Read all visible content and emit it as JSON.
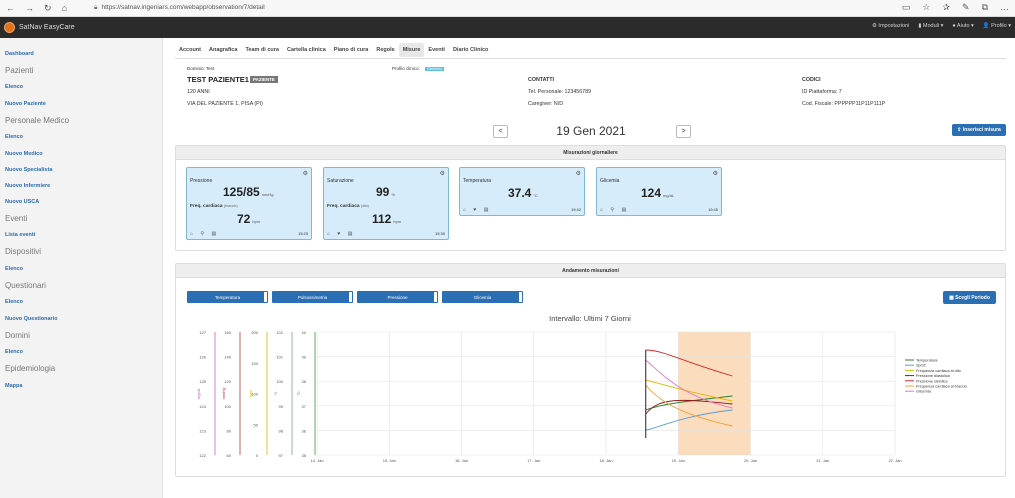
{
  "browser": {
    "url": "https://satnav.ingeniars.com/webapp/observation/7/detail",
    "nav_back": "←",
    "nav_forward": "→",
    "nav_refresh": "↻",
    "nav_home": "⌂",
    "right_icons": [
      "▭",
      "☆",
      "✰",
      "✎",
      "⧉",
      "…"
    ]
  },
  "navbar": {
    "brand": "SatNav EasyCare",
    "menu": [
      "⚙ Impostazioni",
      "▮ Moduli ▾",
      "● Aiuto ▾",
      "👤 Profilo ▾"
    ]
  },
  "sidebar": {
    "entries": [
      {
        "type": "link",
        "label": "Dashboard"
      },
      {
        "type": "section",
        "label": "Pazienti"
      },
      {
        "type": "link",
        "label": "Elenco"
      },
      {
        "type": "link",
        "label": "Nuovo Paziente"
      },
      {
        "type": "section",
        "label": "Personale Medico"
      },
      {
        "type": "link",
        "label": "Elenco"
      },
      {
        "type": "link",
        "label": "Nuovo Medico"
      },
      {
        "type": "link",
        "label": "Nuovo Specialista"
      },
      {
        "type": "link",
        "label": "Nuovo Infermiere"
      },
      {
        "type": "link",
        "label": "Nuovo USCA"
      },
      {
        "type": "section",
        "label": "Eventi"
      },
      {
        "type": "link",
        "label": "Lista eventi"
      },
      {
        "type": "section",
        "label": "Dispositivi"
      },
      {
        "type": "link",
        "label": "Elenco"
      },
      {
        "type": "section",
        "label": "Questionari"
      },
      {
        "type": "link",
        "label": "Elenco"
      },
      {
        "type": "link",
        "label": "Nuovo Questionario"
      },
      {
        "type": "section",
        "label": "Domini"
      },
      {
        "type": "link",
        "label": "Elenco"
      },
      {
        "type": "section",
        "label": "Epidemiologia"
      },
      {
        "type": "link",
        "label": "Mappa"
      }
    ]
  },
  "tabs": [
    {
      "label": "Account",
      "active": false
    },
    {
      "label": "Anagrafica",
      "active": false
    },
    {
      "label": "Team di cura",
      "active": false
    },
    {
      "label": "Cartella clinica",
      "active": false
    },
    {
      "label": "Piano di cura",
      "active": false
    },
    {
      "label": "Regole",
      "active": false
    },
    {
      "label": "Misure",
      "active": true
    },
    {
      "label": "Eventi",
      "active": false
    },
    {
      "label": "Diario Clinico",
      "active": false
    }
  ],
  "patient": {
    "domain": "Dominio: Test",
    "name": "TEST PAZIENTE1",
    "badge": "PAZIENTE",
    "age": "120 ANNI",
    "address": "VIA DEL PAZIENTE 1, PISA (PI)",
    "profile_label": "Profilo clinico:",
    "profile_badge": "Generico",
    "contacts_title": "CONTATTI",
    "phone": "Tel. Personale: 123456789",
    "caregiver": "Caregiver: N/D",
    "codes_title": "CODICI",
    "platform_id": "ID Piattaforma: 7",
    "fiscal_code": "Cod. Fiscale: PPPPPP11P11P111P"
  },
  "date_nav": {
    "prev": "<",
    "date": "19 Gen 2021",
    "next": ">",
    "insert_button": "⇪ Inserisci misura"
  },
  "daily": {
    "title": "Misurazioni giornaliere",
    "cards": [
      {
        "title": "Pressione",
        "value": "125/85",
        "unit": "mmHg",
        "sub_label": "Freq. cardiaca",
        "sub_note": "(braccio)",
        "sub_value": "72",
        "sub_unit": "bpm",
        "icons": "⌂ ⚲ ▤",
        "time": "15:25",
        "gear": "⚙"
      },
      {
        "title": "Saturazione",
        "value": "99",
        "unit": "%",
        "sub_label": "Freq. cardiaca",
        "sub_note": "(dito)",
        "sub_value": "112",
        "sub_unit": "bpm",
        "icons": "⌂ ♥ ▤",
        "time": "15:30",
        "gear": "⚙"
      },
      {
        "title": "Temperatura",
        "value": "37.4",
        "unit": "°C",
        "icons": "⌂ ♥ ▤",
        "time": "19:42",
        "gear": "⚙"
      },
      {
        "title": "Glicemia",
        "value": "124",
        "unit": "mg/dL",
        "icons": "⌂ ⚲ ▤",
        "time": "19:45",
        "gear": "⚙"
      }
    ]
  },
  "trend": {
    "title": "Andamento misurazioni",
    "toggles": [
      "Temperatura",
      "Pulsossimetria",
      "Pressione",
      "Glicemia"
    ],
    "period_button": "▦ Scegli Periodo"
  },
  "chart_data": {
    "type": "line",
    "title": "Intervallo: Ultimi 7 Giorni",
    "x_ticks": [
      "14. Jan",
      "15. Jan",
      "16. Jan",
      "17. Jan",
      "18. Jan",
      "19. Jan",
      "20. Jan",
      "21. Jan",
      "22. Jan"
    ],
    "highlight_band": [
      "19. Jan",
      "20. Jan"
    ],
    "highlight_color": "#fbdcbc",
    "y_axes": [
      {
        "label": "mg/dL",
        "color": "#d957c6",
        "ticks": [
          "127",
          "126",
          "125",
          "124",
          "123",
          "122"
        ]
      },
      {
        "label": "mmHg",
        "color": "#b23b3b",
        "ticks": [
          "160",
          "140",
          "120",
          "100",
          "80",
          "60"
        ]
      },
      {
        "label": "bpm",
        "color": "#e0b400",
        "ticks": [
          "200",
          "150",
          "100",
          "50",
          "0"
        ]
      },
      {
        "label": "%",
        "color": "#7a9abf",
        "ticks": [
          "102",
          "101",
          "100",
          "99",
          "98",
          "97"
        ]
      },
      {
        "label": "°C",
        "color": "#3c9a3c",
        "ticks": [
          "40",
          "39",
          "38",
          "37",
          "36",
          "35"
        ]
      }
    ],
    "series": [
      {
        "name": "Temperatura",
        "color": "#2e7d32"
      },
      {
        "name": "SpO2",
        "color": "#5b9bd5"
      },
      {
        "name": "Frequenza cardiaca al dito",
        "color": "#e6b800"
      },
      {
        "name": "Pressione diastolica",
        "color": "#8b1a1a"
      },
      {
        "name": "Pressione sistolica",
        "color": "#d62728"
      },
      {
        "name": "Frequenza cardiaca al braccio",
        "color": "#f0a030"
      },
      {
        "name": "Glicemia",
        "color": "#e377c2"
      }
    ]
  }
}
